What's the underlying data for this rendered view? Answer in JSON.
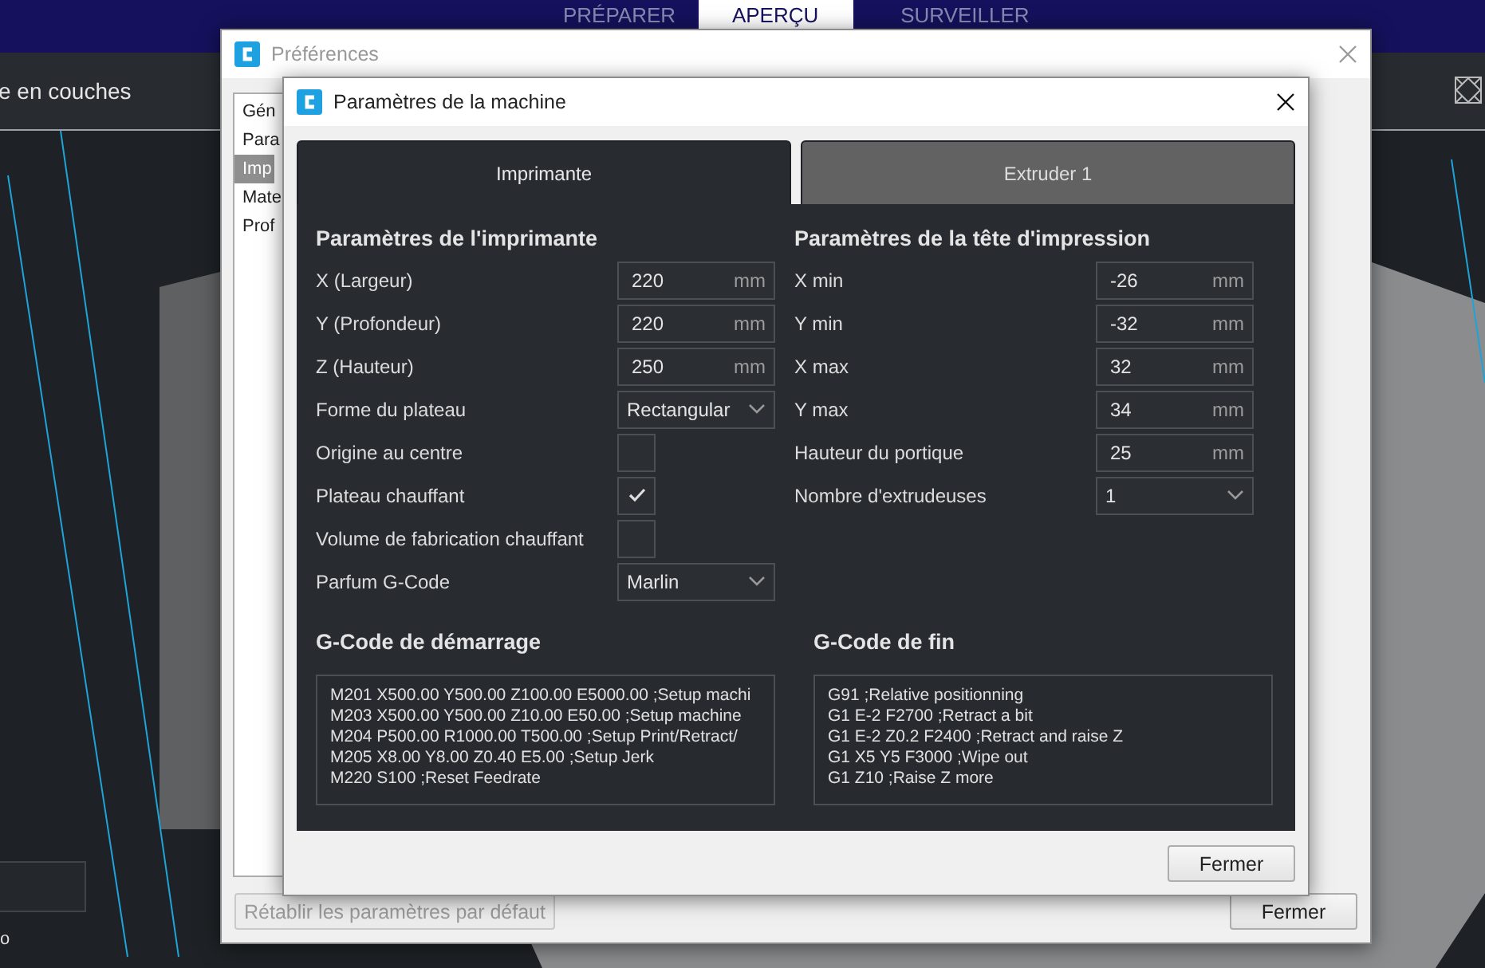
{
  "app": {
    "stage_tabs": [
      {
        "label": "PRÉPARER",
        "selected": false
      },
      {
        "label": "APERÇU",
        "selected": true
      },
      {
        "label": "SURVEILLER",
        "selected": false
      }
    ],
    "panel_title": "e en couches",
    "bottom_label": "o"
  },
  "preferences": {
    "title": "Préférences",
    "sidebar": {
      "items": [
        {
          "label": "Gén",
          "selected": false
        },
        {
          "label": "Para",
          "selected": false
        },
        {
          "label": "Imp",
          "selected": true
        },
        {
          "label": "Mate",
          "selected": false
        },
        {
          "label": "Prof",
          "selected": false
        }
      ]
    },
    "reset_button": {
      "label": "Rétablir les paramètres par défaut",
      "disabled": true
    },
    "close_button": "Fermer"
  },
  "machine_dialog": {
    "title": "Paramètres de la machine",
    "tabs": [
      {
        "label": "Imprimante",
        "selected": true
      },
      {
        "label": "Extruder 1",
        "selected": false
      }
    ],
    "printer": {
      "heading": "Paramètres de l'imprimante",
      "fields": [
        {
          "kind": "number",
          "label": "X (Largeur)",
          "value": "220",
          "unit": "mm"
        },
        {
          "kind": "number",
          "label": "Y (Profondeur)",
          "value": "220",
          "unit": "mm"
        },
        {
          "kind": "number",
          "label": "Z (Hauteur)",
          "value": "250",
          "unit": "mm"
        },
        {
          "kind": "dropdown",
          "label": "Forme du plateau",
          "value": "Rectangular"
        },
        {
          "kind": "checkbox",
          "label": "Origine au centre",
          "checked": false
        },
        {
          "kind": "checkbox",
          "label": "Plateau chauffant",
          "checked": true
        },
        {
          "kind": "checkbox",
          "label": "Volume de fabrication chauffant",
          "checked": false
        },
        {
          "kind": "dropdown",
          "label": "Parfum G-Code",
          "value": "Marlin"
        }
      ]
    },
    "printhead": {
      "heading": "Paramètres de la tête d'impression",
      "fields": [
        {
          "kind": "number",
          "label": "X min",
          "value": "-26",
          "unit": "mm"
        },
        {
          "kind": "number",
          "label": "Y min",
          "value": "-32",
          "unit": "mm"
        },
        {
          "kind": "number",
          "label": "X max",
          "value": "32",
          "unit": "mm"
        },
        {
          "kind": "number",
          "label": "Y max",
          "value": "34",
          "unit": "mm"
        },
        {
          "kind": "number",
          "label": "Hauteur du portique",
          "value": "25",
          "unit": "mm"
        },
        {
          "kind": "dropdown",
          "label": "Nombre d'extrudeuses",
          "value": "1"
        }
      ]
    },
    "start_gcode": {
      "heading": "G-Code de démarrage",
      "lines": [
        "M201 X500.00 Y500.00 Z100.00 E5000.00 ;Setup machi",
        "M203 X500.00 Y500.00 Z10.00 E50.00 ;Setup machine",
        "M204 P500.00 R1000.00 T500.00 ;Setup Print/Retract/",
        "M205 X8.00 Y8.00 Z0.40 E5.00 ;Setup Jerk",
        "M220 S100 ;Reset Feedrate"
      ]
    },
    "end_gcode": {
      "heading": "G-Code de fin",
      "lines": [
        "G91 ;Relative positionning",
        "G1 E-2 F2700 ;Retract a bit",
        "G1 E-2 Z0.2 F2400 ;Retract and raise Z",
        "G1 X5 Y5 F3000 ;Wipe out",
        "G1 Z10 ;Raise Z more"
      ]
    },
    "close_button": "Fermer"
  }
}
